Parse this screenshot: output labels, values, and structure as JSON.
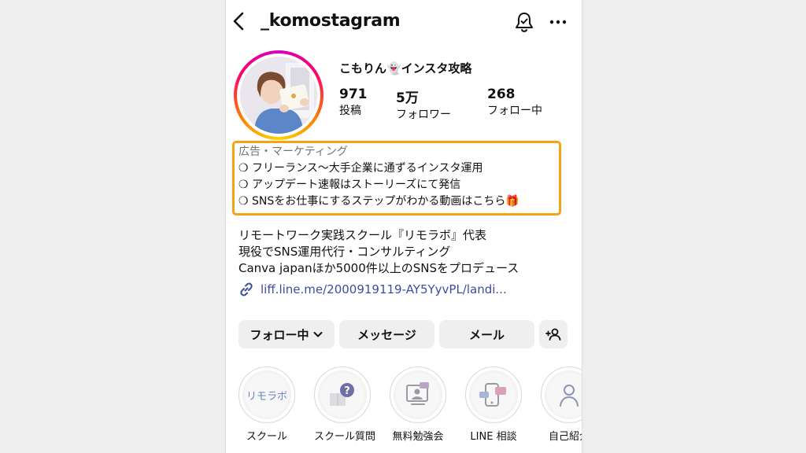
{
  "header": {
    "username": "_komostagram"
  },
  "profile": {
    "display_name": "こもりん👻インスタ攻略",
    "stats": [
      {
        "value": "971",
        "label": "投稿"
      },
      {
        "value": "5万",
        "label": "フォロワー"
      },
      {
        "value": "268",
        "label": "フォロー中"
      }
    ],
    "category": "広告・マーケティング",
    "bio_lines": [
      "❍ フリーランス〜大手企業に通ずるインスタ運用",
      "❍ アップデート速報はストーリーズにて発信",
      "❍ SNSをお仕事にするステップがわかる動画はこちら🎁"
    ],
    "description_lines": [
      "リモートワーク実践スクール『リモラボ』代表",
      "現役でSNS運用代行・コンサルティング",
      "Canva japanほか5000件以上のSNSをプロデュース"
    ],
    "link": "liff.line.me/2000919119-AY5YyvPL/landi..."
  },
  "actions": {
    "following": "フォロー中",
    "message": "メッセージ",
    "email": "メール"
  },
  "highlights": [
    {
      "label": "スクール",
      "cover_text": "リモラボ"
    },
    {
      "label": "スクール質問"
    },
    {
      "label": "無料勉強会"
    },
    {
      "label": "LINE 相談"
    },
    {
      "label": "自己紹介"
    }
  ],
  "colors": {
    "highlight_border": "#f5a213",
    "link": "#3a4fa0",
    "button_bg": "#efefef"
  }
}
